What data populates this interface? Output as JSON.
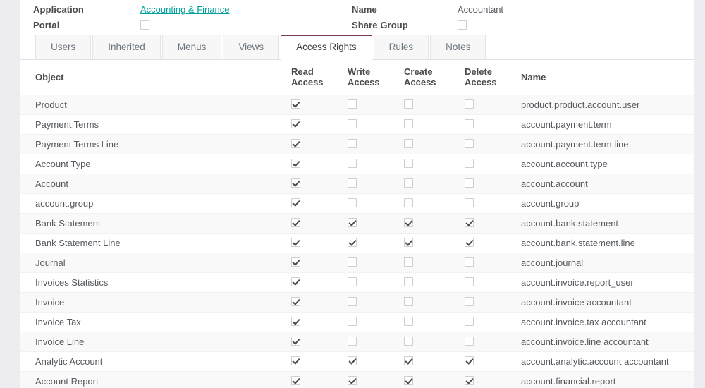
{
  "form": {
    "application_label": "Application",
    "application_value": "Accounting & Finance",
    "portal_label": "Portal",
    "portal_checked": false,
    "name_label": "Name",
    "name_value": "Accountant",
    "share_group_label": "Share Group",
    "share_group_checked": false
  },
  "tabs": [
    {
      "label": "Users",
      "active": false
    },
    {
      "label": "Inherited",
      "active": false
    },
    {
      "label": "Menus",
      "active": false
    },
    {
      "label": "Views",
      "active": false
    },
    {
      "label": "Access Rights",
      "active": true
    },
    {
      "label": "Rules",
      "active": false
    },
    {
      "label": "Notes",
      "active": false
    }
  ],
  "table": {
    "headers": {
      "object": "Object",
      "read_access_line1": "Read",
      "read_access_line2": "Access",
      "write_access_line1": "Write",
      "write_access_line2": "Access",
      "create_access_line1": "Create",
      "create_access_line2": "Access",
      "delete_access_line1": "Delete",
      "delete_access_line2": "Access",
      "name": "Name"
    },
    "rows": [
      {
        "object": "Product",
        "read": true,
        "write": false,
        "create": false,
        "delete": false,
        "name": "product.product.account.user"
      },
      {
        "object": "Payment Terms",
        "read": true,
        "write": false,
        "create": false,
        "delete": false,
        "name": "account.payment.term"
      },
      {
        "object": "Payment Terms Line",
        "read": true,
        "write": false,
        "create": false,
        "delete": false,
        "name": "account.payment.term.line"
      },
      {
        "object": "Account Type",
        "read": true,
        "write": false,
        "create": false,
        "delete": false,
        "name": "account.account.type"
      },
      {
        "object": "Account",
        "read": true,
        "write": false,
        "create": false,
        "delete": false,
        "name": "account.account"
      },
      {
        "object": "account.group",
        "read": true,
        "write": false,
        "create": false,
        "delete": false,
        "name": "account.group"
      },
      {
        "object": "Bank Statement",
        "read": true,
        "write": true,
        "create": true,
        "delete": true,
        "name": "account.bank.statement"
      },
      {
        "object": "Bank Statement Line",
        "read": true,
        "write": true,
        "create": true,
        "delete": true,
        "name": "account.bank.statement.line"
      },
      {
        "object": "Journal",
        "read": true,
        "write": false,
        "create": false,
        "delete": false,
        "name": "account.journal"
      },
      {
        "object": "Invoices Statistics",
        "read": true,
        "write": false,
        "create": false,
        "delete": false,
        "name": "account.invoice.report_user"
      },
      {
        "object": "Invoice",
        "read": true,
        "write": false,
        "create": false,
        "delete": false,
        "name": "account.invoice accountant"
      },
      {
        "object": "Invoice Tax",
        "read": true,
        "write": false,
        "create": false,
        "delete": false,
        "name": "account.invoice.tax accountant"
      },
      {
        "object": "Invoice Line",
        "read": true,
        "write": false,
        "create": false,
        "delete": false,
        "name": "account.invoice.line accountant"
      },
      {
        "object": "Analytic Account",
        "read": true,
        "write": true,
        "create": true,
        "delete": true,
        "name": "account.analytic.account accountant"
      },
      {
        "object": "Account Report",
        "read": true,
        "write": true,
        "create": true,
        "delete": true,
        "name": "account.financial.report"
      }
    ]
  },
  "colors": {
    "link": "#00a09d",
    "active_tab_accent": "#7c3c58",
    "page_background": "#ececf1",
    "row_stripe": "#f9f9f9"
  }
}
